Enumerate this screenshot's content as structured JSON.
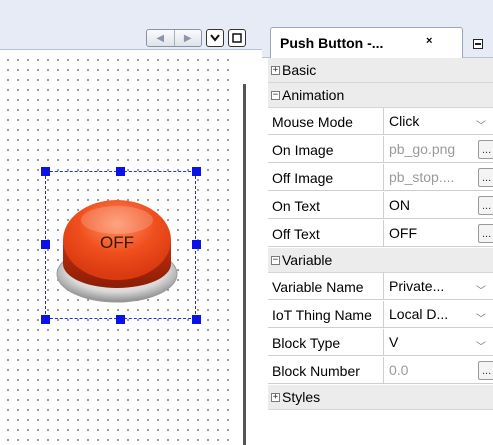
{
  "tab": {
    "title": "Push Button -...",
    "close": "×"
  },
  "toolbar": {
    "prev_glyph": "◀",
    "next_glyph": "▶"
  },
  "widget": {
    "label": "OFF"
  },
  "categories": {
    "basic": {
      "label": "Basic",
      "toggle": "+"
    },
    "animation": {
      "label": "Animation",
      "toggle": "−"
    },
    "variable": {
      "label": "Variable",
      "toggle": "−"
    },
    "styles": {
      "label": "Styles",
      "toggle": "+"
    }
  },
  "properties": {
    "mouse_mode": {
      "name": "Mouse Mode",
      "value": "Click"
    },
    "on_image": {
      "name": "On Image",
      "value": "pb_go.png"
    },
    "off_image": {
      "name": "Off Image",
      "value": "pb_stop...."
    },
    "on_text": {
      "name": "On Text",
      "value": "ON"
    },
    "off_text": {
      "name": "Off Text",
      "value": "OFF"
    },
    "variable_name": {
      "name": "Variable Name",
      "value": "Private..."
    },
    "iot_thing_name": {
      "name": "IoT Thing Name",
      "value": "Local D..."
    },
    "block_type": {
      "name": "Block Type",
      "value": "V"
    },
    "block_number": {
      "name": "Block Number",
      "value": "0.0"
    }
  },
  "glyphs": {
    "dropdown": "﹀",
    "ellipsis": "..."
  },
  "colors": {
    "selection": "#0a12e8",
    "button_red": "#e8431a",
    "header_bg": "#e6ebf5"
  }
}
